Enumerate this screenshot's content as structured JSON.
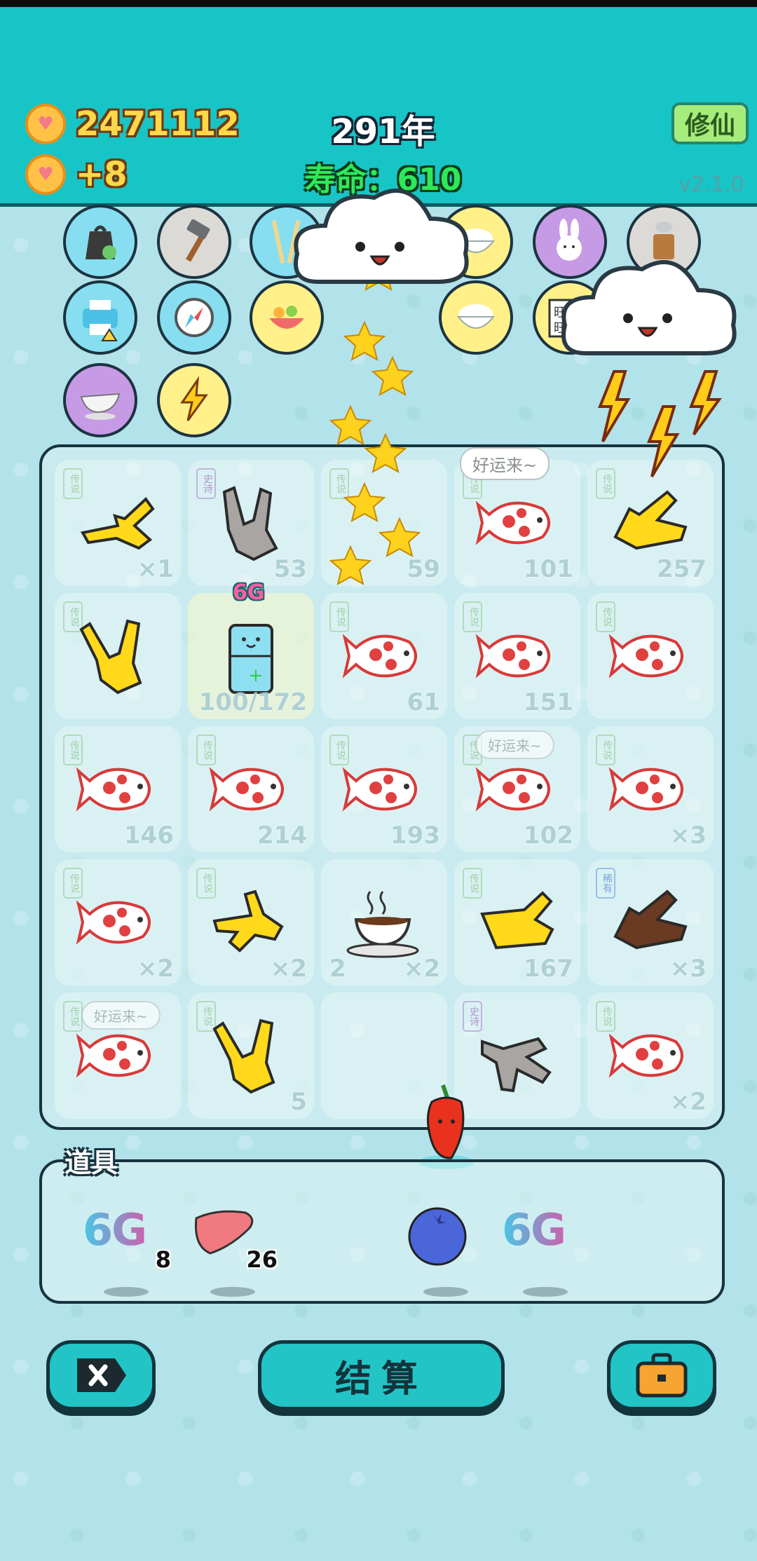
{
  "header": {
    "coins": "2471112",
    "income": "+8",
    "year_text": "291年",
    "life_text": "寿命：610",
    "xiuxian_label": "修仙",
    "version": "v2.1.0"
  },
  "top_items": [
    {
      "name": "recycle-bag-icon",
      "color": "c-blue"
    },
    {
      "name": "hammer-icon",
      "color": "c-gray"
    },
    {
      "name": "chopsticks-icon",
      "color": "c-blue"
    },
    {
      "name": "rice-bowl-icon",
      "color": "c-yellow"
    },
    {
      "name": "bunny-icon",
      "color": "c-purple"
    },
    {
      "name": "grinder-icon",
      "color": "c-gray"
    },
    {
      "name": "printer-icon",
      "color": "c-blue"
    },
    {
      "name": "compass-icon",
      "color": "c-blue"
    },
    {
      "name": "fruit-platter-icon",
      "color": "c-yellow"
    },
    {
      "name": "rice-bowl-icon",
      "color": "c-yellow"
    },
    {
      "name": "wangwang-icon",
      "color": "c-yellow"
    },
    {
      "name": "gravy-boat-icon",
      "color": "c-purple"
    },
    {
      "name": "lightning-icon",
      "color": "c-yellow"
    }
  ],
  "board": {
    "bubble_top": "好运来~",
    "bubble_mid": "好运来~",
    "bubble_low": "好运来~",
    "cell_label_legend": "传说",
    "cell_label_rare": "稀有",
    "cell_label_epic": "史诗",
    "cells": [
      {
        "item": "hand-yellow",
        "num": "×1"
      },
      {
        "item": "hand-gray",
        "num": "53"
      },
      {
        "item": "stars",
        "num": "59"
      },
      {
        "item": "fish",
        "num": "101"
      },
      {
        "item": "hand-yellow",
        "num": "257"
      },
      {
        "item": "hand-yellow",
        "num": ""
      },
      {
        "item": "fridge",
        "num": "100/172"
      },
      {
        "item": "fish",
        "num": "61"
      },
      {
        "item": "fish",
        "num": "151"
      },
      {
        "item": "fish",
        "num": ""
      },
      {
        "item": "fish",
        "num": "146"
      },
      {
        "item": "fish",
        "num": "214"
      },
      {
        "item": "fish",
        "num": "193"
      },
      {
        "item": "fish",
        "num": "102"
      },
      {
        "item": "fish",
        "num": "×3"
      },
      {
        "item": "fish",
        "num": "×2"
      },
      {
        "item": "hand-yellow",
        "num": "×2"
      },
      {
        "item": "coffee",
        "num": "×2",
        "num_left": "2"
      },
      {
        "item": "hand-yellow",
        "num": "167"
      },
      {
        "item": "hand-brown",
        "num": "×3"
      },
      {
        "item": "fish",
        "num": ""
      },
      {
        "item": "hand-yellow",
        "num": "5"
      },
      {
        "item": "empty",
        "num": ""
      },
      {
        "item": "hand-gray",
        "num": ""
      },
      {
        "item": "fish",
        "num": "×2"
      }
    ],
    "fridge_label": "6G"
  },
  "tools": {
    "title": "道具",
    "items": [
      {
        "name": "6g-tool",
        "text": "6G",
        "count": "8"
      },
      {
        "name": "liver-tool",
        "count": "26"
      },
      {
        "name": "blueberry-tool"
      },
      {
        "name": "6g-tool",
        "text": "6G"
      }
    ]
  },
  "buttons": {
    "settle": "结算"
  },
  "colors": {
    "header": "#17c5c6",
    "background": "#b2e2ea",
    "button": "#22c4c6"
  }
}
